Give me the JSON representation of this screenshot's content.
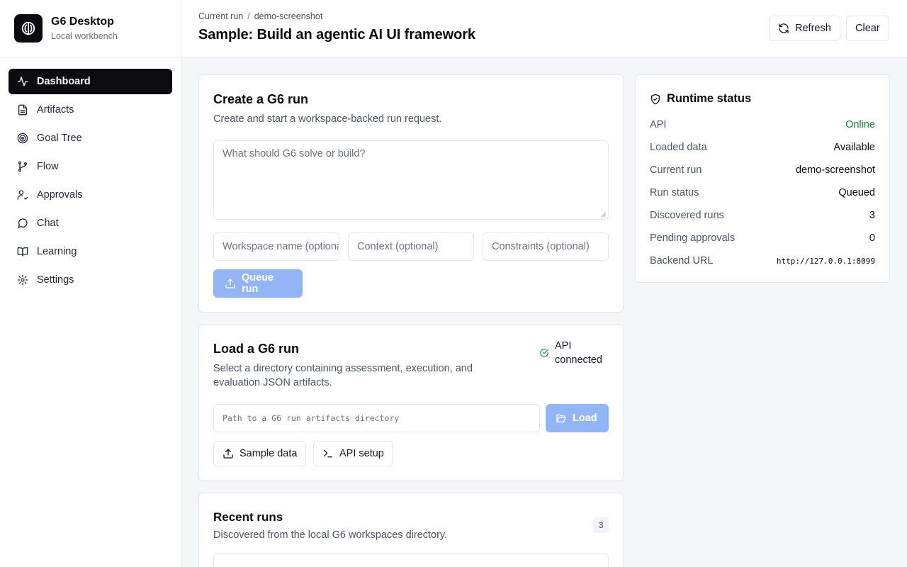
{
  "app": {
    "title": "G6 Desktop",
    "subtitle": "Local workbench"
  },
  "sidebar": {
    "items": [
      {
        "label": "Dashboard",
        "icon": "activity-icon",
        "active": true
      },
      {
        "label": "Artifacts",
        "icon": "file-text-icon"
      },
      {
        "label": "Goal Tree",
        "icon": "target-icon"
      },
      {
        "label": "Flow",
        "icon": "git-branch-icon"
      },
      {
        "label": "Approvals",
        "icon": "user-check-icon"
      },
      {
        "label": "Chat",
        "icon": "message-circle-icon"
      },
      {
        "label": "Learning",
        "icon": "book-open-icon"
      },
      {
        "label": "Settings",
        "icon": "gear-icon"
      }
    ]
  },
  "header": {
    "breadcrumb": [
      "Current run",
      "demo-screenshot"
    ],
    "breadcrumb_sep": "/",
    "title": "Sample: Build an agentic AI UI framework",
    "refresh_label": "Refresh",
    "clear_label": "Clear"
  },
  "create_run": {
    "title": "Create a G6 run",
    "subtitle": "Create and start a workspace-backed run request.",
    "prompt_placeholder": "What should G6 solve or build?",
    "workspace_placeholder": "Workspace name (optional)",
    "context_placeholder": "Context (optional)",
    "constraints_placeholder": "Constraints (optional)",
    "queue_label": "Queue run"
  },
  "load_run": {
    "title": "Load a G6 run",
    "subtitle": "Select a directory containing assessment, execution, and evaluation JSON artifacts.",
    "api_status_line1": "API",
    "api_status_line2": "connected",
    "path_placeholder": "Path to a G6 run artifacts directory",
    "load_label": "Load",
    "sample_label": "Sample data",
    "api_setup_label": "API setup"
  },
  "recent_runs": {
    "title": "Recent runs",
    "subtitle": "Discovered from the local G6 workspaces directory.",
    "count": "3"
  },
  "runtime_status": {
    "title": "Runtime status",
    "rows": [
      {
        "key": "API",
        "value": "Online"
      },
      {
        "key": "Loaded data",
        "value": "Available"
      },
      {
        "key": "Current run",
        "value": "demo-screenshot"
      },
      {
        "key": "Run status",
        "value": "Queued"
      },
      {
        "key": "Discovered runs",
        "value": "3"
      },
      {
        "key": "Pending approvals",
        "value": "0"
      },
      {
        "key": "Backend URL",
        "value": "http://127.0.0.1:8099"
      }
    ]
  },
  "colors": {
    "primary_disabled": "#93b4f5",
    "active_nav": "#0b0b10",
    "online": "#15803d",
    "connected": "#16a34a"
  }
}
